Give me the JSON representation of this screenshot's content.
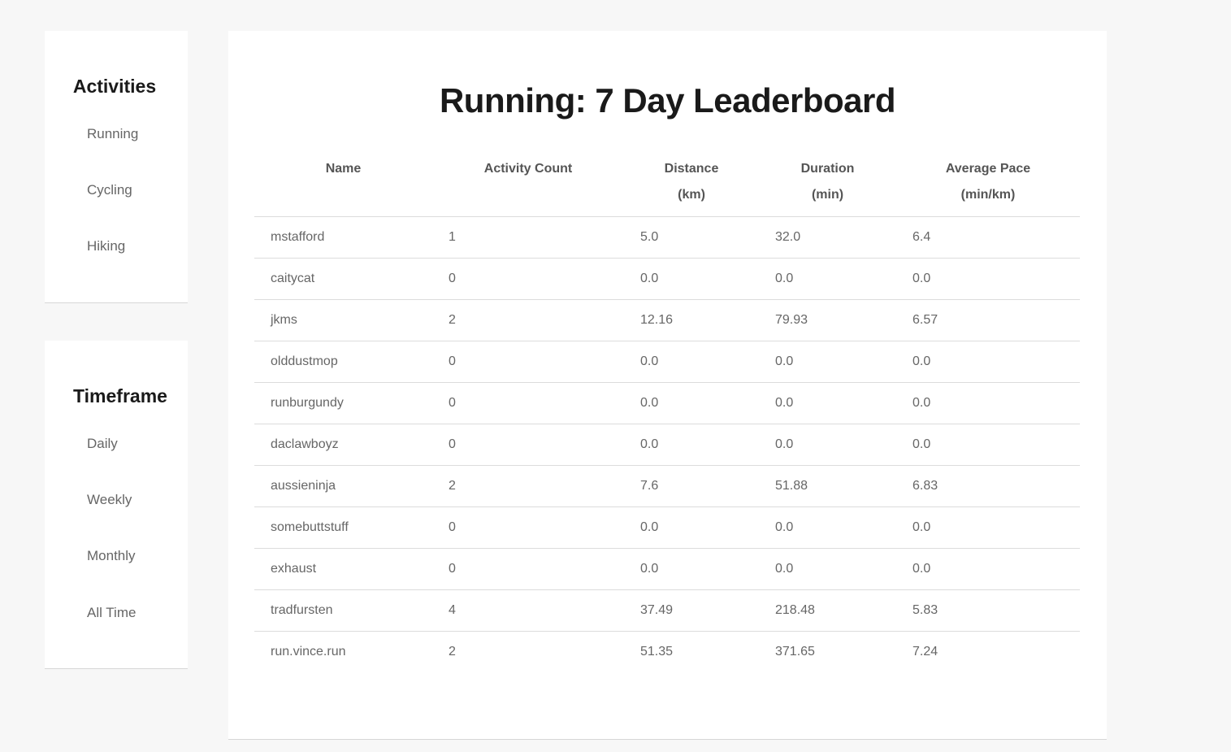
{
  "sidebar": {
    "activities": {
      "title": "Activities",
      "items": [
        {
          "label": "Running"
        },
        {
          "label": "Cycling"
        },
        {
          "label": "Hiking"
        }
      ]
    },
    "timeframe": {
      "title": "Timeframe",
      "items": [
        {
          "label": "Daily"
        },
        {
          "label": "Weekly"
        },
        {
          "label": "Monthly"
        },
        {
          "label": "All Time"
        }
      ]
    }
  },
  "main": {
    "title": "Running: 7 Day Leaderboard",
    "table": {
      "headers": [
        {
          "line1": "Name",
          "line2": ""
        },
        {
          "line1": "Activity Count",
          "line2": ""
        },
        {
          "line1": "Distance",
          "line2": "(km)"
        },
        {
          "line1": "Duration",
          "line2": "(min)"
        },
        {
          "line1": "Average Pace",
          "line2": "(min/km)"
        }
      ],
      "rows": [
        {
          "name": "mstafford",
          "count": "1",
          "distance": "5.0",
          "duration": "32.0",
          "pace": "6.4"
        },
        {
          "name": "caitycat",
          "count": "0",
          "distance": "0.0",
          "duration": "0.0",
          "pace": "0.0"
        },
        {
          "name": "jkms",
          "count": "2",
          "distance": "12.16",
          "duration": "79.93",
          "pace": "6.57"
        },
        {
          "name": "olddustmop",
          "count": "0",
          "distance": "0.0",
          "duration": "0.0",
          "pace": "0.0"
        },
        {
          "name": "runburgundy",
          "count": "0",
          "distance": "0.0",
          "duration": "0.0",
          "pace": "0.0"
        },
        {
          "name": "daclawboyz",
          "count": "0",
          "distance": "0.0",
          "duration": "0.0",
          "pace": "0.0"
        },
        {
          "name": "aussieninja",
          "count": "2",
          "distance": "7.6",
          "duration": "51.88",
          "pace": "6.83"
        },
        {
          "name": "somebuttstuff",
          "count": "0",
          "distance": "0.0",
          "duration": "0.0",
          "pace": "0.0"
        },
        {
          "name": "exhaust",
          "count": "0",
          "distance": "0.0",
          "duration": "0.0",
          "pace": "0.0"
        },
        {
          "name": "tradfursten",
          "count": "4",
          "distance": "37.49",
          "duration": "218.48",
          "pace": "5.83"
        },
        {
          "name": "run.vince.run",
          "count": "2",
          "distance": "51.35",
          "duration": "371.65",
          "pace": "7.24"
        }
      ]
    }
  }
}
